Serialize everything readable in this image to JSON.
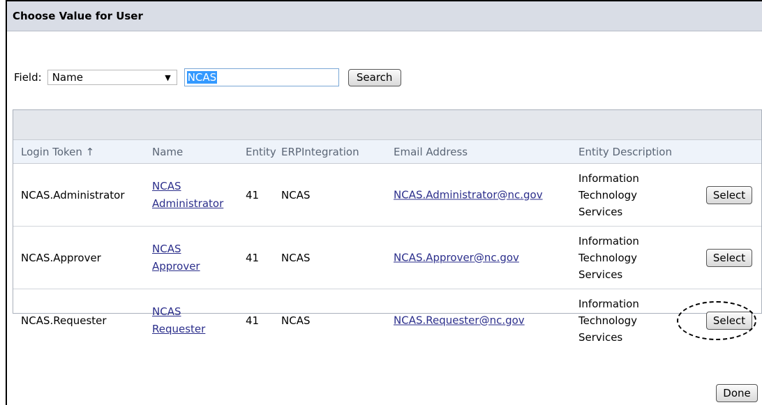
{
  "dialog": {
    "title": "Choose Value for User"
  },
  "search": {
    "field_label": "Field:",
    "field_value": "Name",
    "query": "NCAS",
    "search_button": "Search"
  },
  "table": {
    "columns": [
      "Login Token ↑",
      "Name",
      "Entity",
      "ERPIntegration",
      "Email Address",
      "Entity Description"
    ],
    "rows": [
      {
        "login_token": "NCAS.Administrator",
        "name_line1": "NCAS",
        "name_line2": "Administrator",
        "entity": "41",
        "erp": "NCAS",
        "email": "NCAS.Administrator@nc.gov",
        "desc1": "Information",
        "desc2": "Technology",
        "desc3": "Services",
        "action": "Select"
      },
      {
        "login_token": "NCAS.Approver",
        "name_line1": "NCAS",
        "name_line2": "Approver",
        "entity": "41",
        "erp": "NCAS",
        "email": "NCAS.Approver@nc.gov",
        "desc1": "Information",
        "desc2": "Technology",
        "desc3": "Services",
        "action": "Select"
      },
      {
        "login_token": "NCAS.Requester",
        "name_line1": "NCAS",
        "name_line2": "Requester",
        "entity": "41",
        "erp": "NCAS",
        "email": "NCAS.Requester@nc.gov",
        "desc1": "Information",
        "desc2": "Technology",
        "desc3": "Services",
        "action": "Select"
      }
    ]
  },
  "footer": {
    "done_button": "Done"
  }
}
